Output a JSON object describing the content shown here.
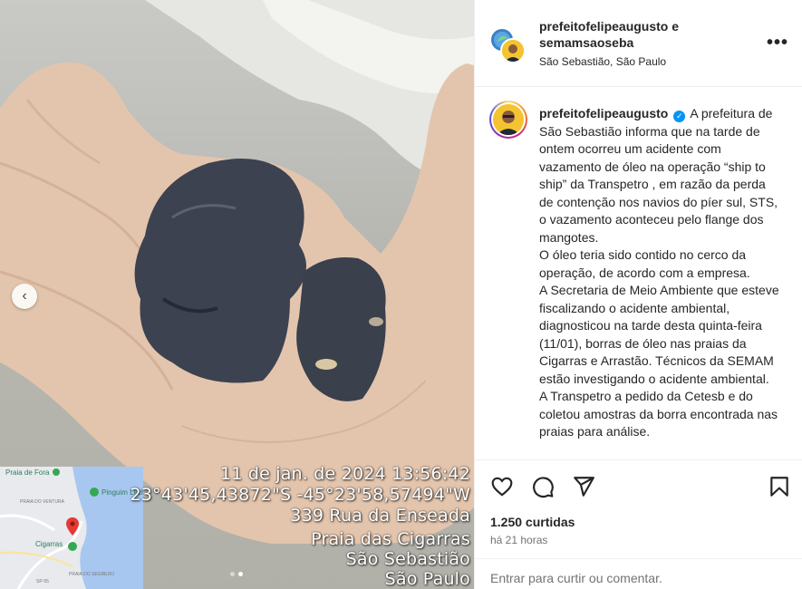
{
  "media": {
    "stamp_lines": [
      "11 de jan. de 2024 13:56:42",
      "23°43'45,43872\"S -45°23'58,57494\"W",
      "339 Rua da Enseada",
      "Praia das Cigarras",
      "São Sebastião",
      "São Paulo"
    ],
    "map_labels": {
      "praia_de_fora": "Praia de Fora",
      "pinguim": "Pinguim Lech",
      "cigarras": "Cigarras",
      "praia_ventura": "PRAIA DO VENTURA",
      "praia_segredo": "PRAIA DO SEGREDO",
      "sp": "SP-55"
    },
    "carousel": {
      "current": 2,
      "total": 2
    }
  },
  "header": {
    "names": "prefeitofelipeaugusto e semamsaoseba",
    "location": "São Sebastião, São Paulo",
    "more_icon": "more-horizontal-icon"
  },
  "caption": {
    "username": "prefeitofelipeaugusto",
    "paragraphs": [
      "A prefeitura de São Sebastião informa que na tarde de ontem ocorreu um acidente com vazamento de óleo na operação “ship to ship” da Transpetro , em razão da perda de contenção nos navios do píer sul, STS, o vazamento aconteceu pelo flange dos mangotes.",
      "O óleo teria sido contido no cerco da operação, de acordo com a empresa.",
      "A Secretaria de Meio Ambiente que esteve fiscalizando o acidente ambiental, diagnosticou na tarde desta quinta-feira (11/01), borras de óleo nas praias da Cigarras e Arrastão. Técnicos da SEMAM estão investigando o acidente ambiental.",
      "A Transpetro a pedido da Cetesb e do coletou amostras da borra encontrada nas praias para análise."
    ]
  },
  "actions": {
    "likes": "1.250 curtidas",
    "time": "há 21 horas",
    "comment_placeholder": "Entrar para curtir ou comentar."
  },
  "colors": {
    "verified": "#0095f6",
    "muted": "#737373",
    "border": "#efefef",
    "map_pin": "#e53935"
  }
}
